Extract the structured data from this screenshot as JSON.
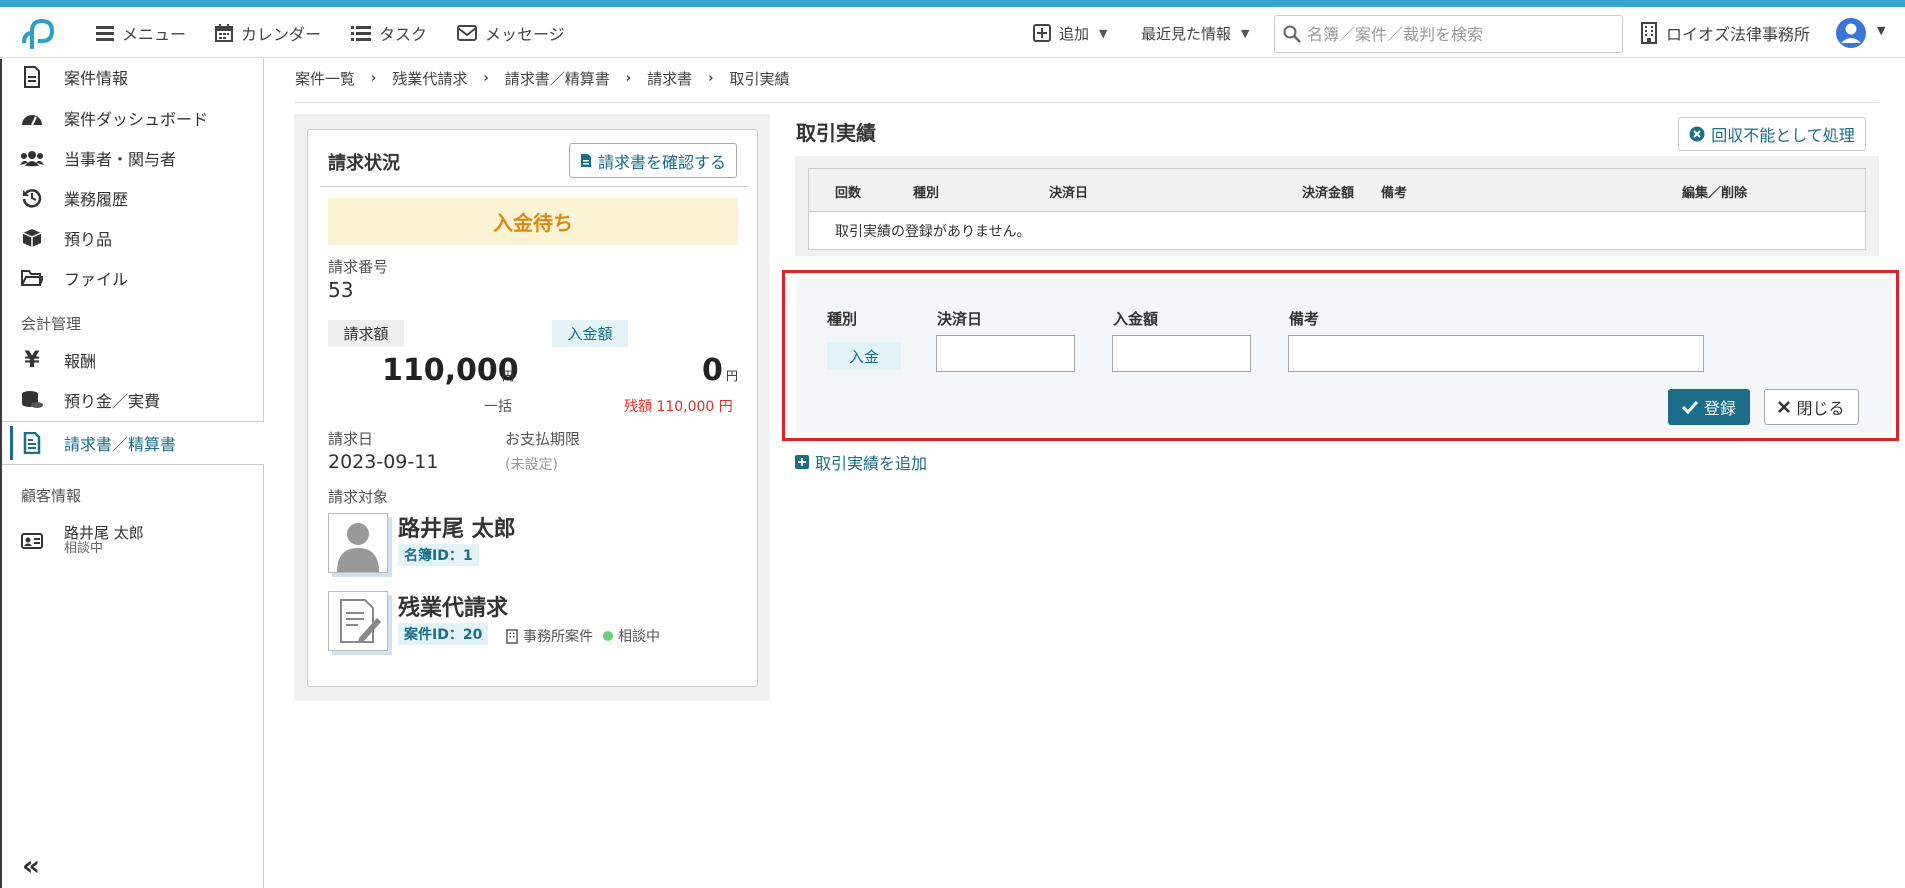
{
  "colors": {
    "accent": "#1b6d8a",
    "stripe": "#3aa3cc",
    "highlight": "#d9242b",
    "pending": "#d78b13",
    "remaining": "#d9342b"
  },
  "header": {
    "menu": "メニュー",
    "calendar": "カレンダー",
    "tasks": "タスク",
    "messages": "メッセージ",
    "add": "追加",
    "recent": "最近見た情報",
    "search_placeholder": "名簿／案件／裁判を検索",
    "office": "ロイオズ法律事務所"
  },
  "sidebar": {
    "items": [
      {
        "label": "案件情報",
        "icon": "document-icon"
      },
      {
        "label": "案件ダッシュボード",
        "icon": "dashboard-icon"
      },
      {
        "label": "当事者・関与者",
        "icon": "users-icon"
      },
      {
        "label": "業務履歴",
        "icon": "history-icon"
      },
      {
        "label": "預り品",
        "icon": "box-icon"
      },
      {
        "label": "ファイル",
        "icon": "folder-icon"
      }
    ],
    "section_accounting": "会計管理",
    "accounting_items": [
      {
        "label": "報酬",
        "icon": "yen-icon"
      },
      {
        "label": "預り金／実費",
        "icon": "coins-icon"
      },
      {
        "label": "請求書／精算書",
        "icon": "invoice-icon"
      }
    ],
    "section_client": "顧客情報",
    "client": {
      "name": "路井尾 太郎",
      "status": "相談中"
    }
  },
  "breadcrumb": [
    "案件一覧",
    "残業代請求",
    "請求書／精算書",
    "請求書",
    "取引実績"
  ],
  "invoice": {
    "title": "請求状況",
    "confirm_button": "請求書を確認する",
    "status": "入金待ち",
    "number_label": "請求番号",
    "number": "53",
    "billed_label": "請求額",
    "paid_label": "入金額",
    "billed_amount": "110,000",
    "paid_amount": "0",
    "unit": "円",
    "billed_note": "一括",
    "remaining": "残額 110,000 円",
    "date_label": "請求日",
    "date": "2023-09-11",
    "due_label": "お支払期限",
    "due": "(未設定)",
    "target_label": "請求対象",
    "person_name": "路井尾 太郎",
    "person_id": "名簿ID：1",
    "case_name": "残業代請求",
    "case_id": "案件ID：20",
    "case_type": "事務所案件",
    "case_status": "相談中"
  },
  "transactions": {
    "title": "取引実績",
    "uncollectible_button": "回収不能として処理",
    "columns": [
      "回数",
      "種別",
      "決済日",
      "決済金額",
      "備考",
      "編集／削除"
    ],
    "empty": "取引実績の登録がありません。",
    "add_link": "取引実績を追加"
  },
  "form": {
    "type_label": "種別",
    "type_value": "入金",
    "date_label": "決済日",
    "amount_label": "入金額",
    "note_label": "備考",
    "date_value": "",
    "amount_value": "",
    "note_value": "",
    "save_button": "登録",
    "close_button": "閉じる"
  }
}
